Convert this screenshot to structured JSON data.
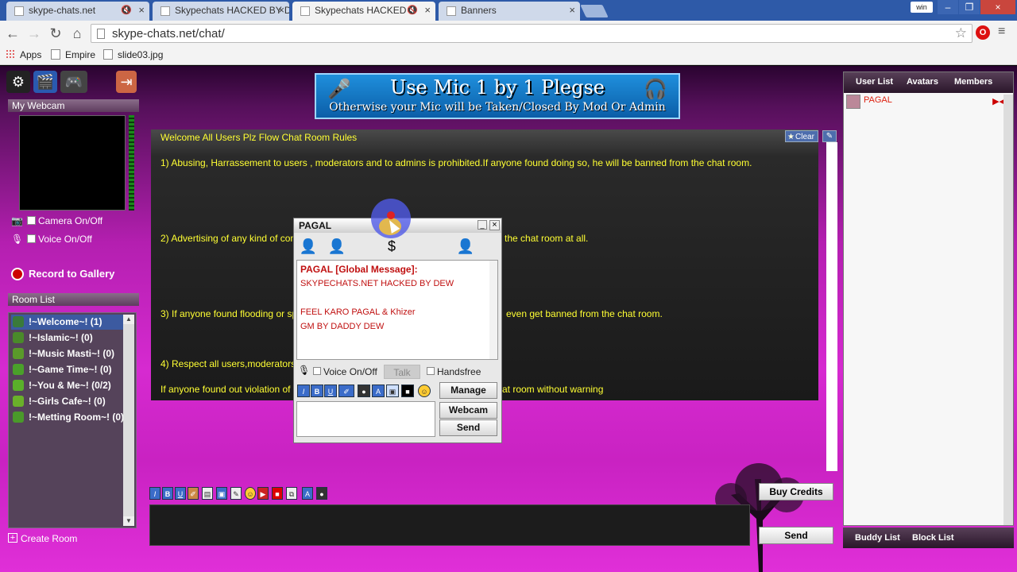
{
  "browser": {
    "tabs": [
      {
        "title": "skype-chats.net",
        "muted": true
      },
      {
        "title": "Skypechats HACKED BY D",
        "muted": false
      },
      {
        "title": "Skypechats HACKED B",
        "muted": true,
        "active": true
      },
      {
        "title": "Banners",
        "muted": false
      }
    ],
    "window_user": "win",
    "url": "skype-chats.net/chat/",
    "bookmarks": [
      "Apps",
      "Empire",
      "slide03.jpg"
    ]
  },
  "banner": {
    "line1": "Use Mic 1 by 1 Plegse",
    "line2": "Otherwise your Mic will be Taken/Closed By Mod Or Admin"
  },
  "webcam": {
    "title": "My Webcam",
    "camera_label": "Camera On/Off",
    "voice_label": "Voice On/Off",
    "record_label": "Record to Gallery"
  },
  "rooms": {
    "title": "Room List",
    "items": [
      {
        "name": "!~Welcome~! (1)",
        "color": "#3a7a3a"
      },
      {
        "name": "!~Islamic~! (0)",
        "color": "#4a8a2a"
      },
      {
        "name": "!~Music Masti~! (0)",
        "color": "#5a9a2a"
      },
      {
        "name": "!~Game Time~! (0)",
        "color": "#4aa02a"
      },
      {
        "name": "!~You & Me~! (0/2)",
        "color": "#5ab02a"
      },
      {
        "name": "!~Girls Cafe~! (0)",
        "color": "#6ab02a"
      },
      {
        "name": "!~Metting Room~! (0)",
        "color": "#4a9a2a"
      }
    ],
    "create_label": "Create Room"
  },
  "chat": {
    "clear_label": "Clear",
    "rules": [
      "Welcome All Users Plz Flow Chat Room Rules",
      "1) Abusing, Harrassement to users , moderators and to admins is prohibited.If anyone found doing so, he will be banned from the chat room.",
      "2) Advertising of any kind of con",
      "3) If anyone found flooding or sp",
      "4) Respect all users,moderators a",
      "If anyone found out violation of"
    ],
    "rules_tail": [
      "the chat room at all.",
      "even get banned from the chat room.",
      "at room without warning"
    ]
  },
  "popup": {
    "title": "PAGAL",
    "sender": "PAGAL [Global Message]:",
    "lines": [
      "SKYPECHATS.NET HACKED BY DEW",
      "",
      "FEEL KARO PAGAL & Khizer",
      "GM BY DADDY DEW"
    ],
    "voice_label": "Voice On/Off",
    "talk_label": "Talk",
    "handsfree_label": "Handsfree",
    "manage_label": "Manage",
    "webcam_label": "Webcam",
    "send_label": "Send"
  },
  "bottom": {
    "buy_credits": "Buy Credits",
    "send_label": "Send"
  },
  "right_panel": {
    "tabs": [
      "User List",
      "Avatars",
      "Members"
    ],
    "users": [
      {
        "name": "PAGAL"
      }
    ],
    "bottom_tabs": [
      "Buddy List",
      "Block List"
    ]
  }
}
